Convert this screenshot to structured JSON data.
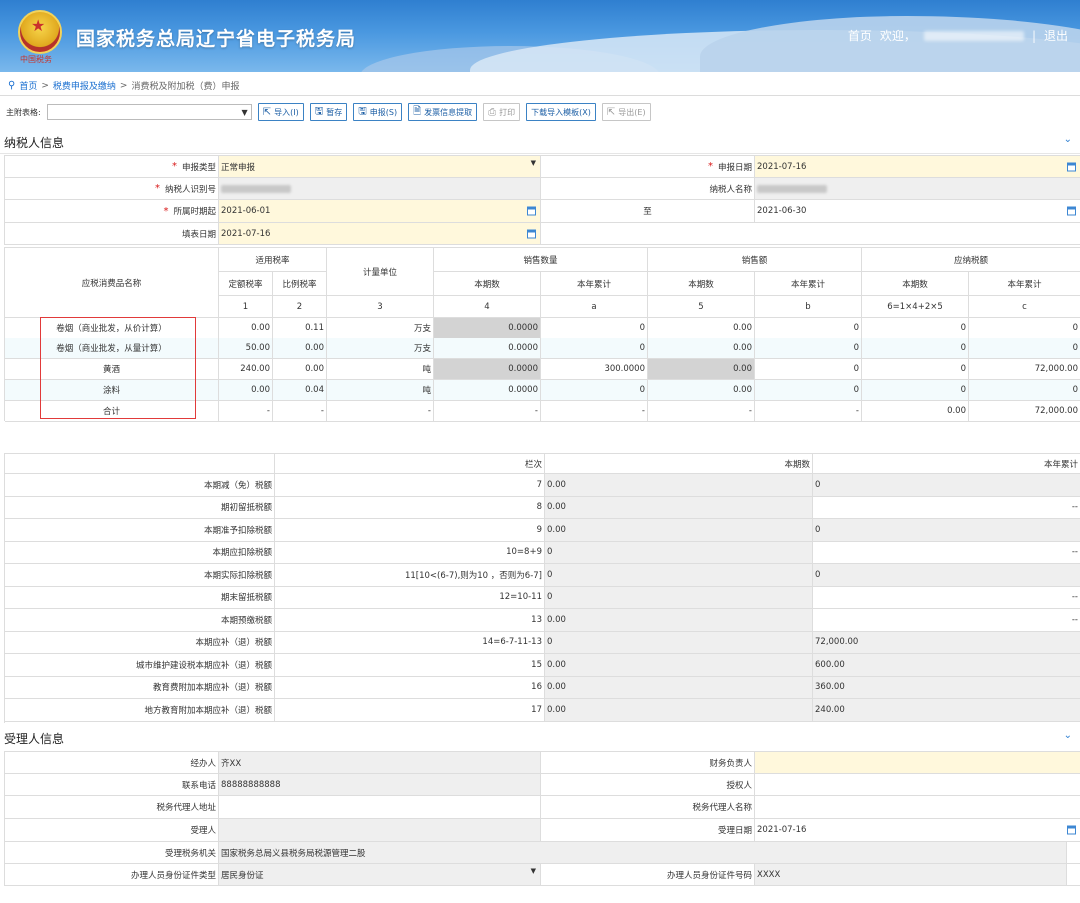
{
  "header": {
    "title": "国家税务总局辽宁省电子税务局",
    "emblem_text": "中国税务",
    "links": {
      "home": "首页",
      "welcome": "欢迎，",
      "sep": "|",
      "logout": "退出"
    }
  },
  "breadcrumb": {
    "items": [
      "首页",
      "税费申报及缴纳",
      "消费税及附加税（费）申报"
    ]
  },
  "toolbar": {
    "label": "主附表格:",
    "import": "导入(I)",
    "save": "暂存",
    "submit": "申报(S)",
    "invoice": "发票信息提取",
    "print": "打印",
    "download": "下载导入模板(X)",
    "export": "导出(E)"
  },
  "taxpayer": {
    "section": "纳税人信息",
    "decl_type_label": "申报类型",
    "decl_type": "正常申报",
    "decl_date_label": "申报日期",
    "decl_date": "2021-07-16",
    "tin_label": "纳税人识别号",
    "name_label": "纳税人名称",
    "period_start_label": "所属时期起",
    "period_start": "2021-06-01",
    "to_label": "至",
    "period_end": "2021-06-30",
    "fill_date_label": "填表日期",
    "fill_date": "2021-07-16"
  },
  "goods": {
    "headers": {
      "name": "应税消费品名称",
      "rate": "适用税率",
      "fixed": "定额税率",
      "ratio": "比例税率",
      "unit": "计量单位",
      "qty": "销售数量",
      "sales": "销售额",
      "tax": "应纳税额",
      "cur": "本期数",
      "ytd": "本年累计"
    },
    "codes": [
      "1",
      "2",
      "3",
      "4",
      "a",
      "5",
      "b",
      "6=1×4+2×5",
      "c"
    ],
    "rows": [
      [
        "卷烟（商业批发，从价计算）",
        "0.00",
        "0.11",
        "万支",
        "0.0000",
        "0",
        "0.00",
        "0",
        "0",
        "0"
      ],
      [
        "卷烟（商业批发，从量计算）",
        "50.00",
        "0.00",
        "万支",
        "0.0000",
        "0",
        "0.00",
        "0",
        "0",
        "0"
      ],
      [
        "黄酒",
        "240.00",
        "0.00",
        "吨",
        "0.0000",
        "300.0000",
        "0.00",
        "0",
        "0",
        "72,000.00"
      ],
      [
        "涂料",
        "0.00",
        "0.04",
        "吨",
        "0.0000",
        "0",
        "0.00",
        "0",
        "0",
        "0"
      ],
      [
        "合计",
        "-",
        "-",
        "-",
        "-",
        "-",
        "-",
        "-",
        "0.00",
        "72,000.00"
      ]
    ]
  },
  "calc": {
    "headers": {
      "line": "栏次",
      "cur": "本期数",
      "ytd": "本年累计"
    },
    "rows": [
      [
        "本期减（免）税额",
        "7",
        "0.00",
        "0"
      ],
      [
        "期初留抵税额",
        "8",
        "0.00",
        "--"
      ],
      [
        "本期准予扣除税额",
        "9",
        "0.00",
        "0"
      ],
      [
        "本期应扣除税额",
        "10=8+9",
        "0",
        "--"
      ],
      [
        "本期实际扣除税额",
        "11[10<(6-7),则为10 ，否则为6-7]",
        "0",
        "0"
      ],
      [
        "期末留抵税额",
        "12=10-11",
        "0",
        "--"
      ],
      [
        "本期预缴税额",
        "13",
        "0.00",
        "--"
      ],
      [
        "本期应补（退）税额",
        "14=6-7-11-13",
        "0",
        "72,000.00"
      ],
      [
        "城市维护建设税本期应补（退）税额",
        "15",
        "0.00",
        "600.00"
      ],
      [
        "教育费附加本期应补（退）税额",
        "16",
        "0.00",
        "360.00"
      ],
      [
        "地方教育附加本期应补（退）税额",
        "17",
        "0.00",
        "240.00"
      ]
    ]
  },
  "agent": {
    "section": "受理人信息",
    "handler_label": "经办人",
    "handler": "齐XX",
    "cfo_label": "财务负责人",
    "cfo": "",
    "phone_label": "联系电话",
    "phone": "88888888888",
    "auth_label": "授权人",
    "auth": "",
    "agent_addr_label": "税务代理人地址",
    "agent_addr": "",
    "agent_name_label": "税务代理人名称",
    "agent_name": "",
    "receiver_label": "受理人",
    "receiver": "",
    "recv_date_label": "受理日期",
    "recv_date": "2021-07-16",
    "office_label": "受理税务机关",
    "office": "国家税务总局义县税务局税源管理二股",
    "id_type_label": "办理人员身份证件类型",
    "id_type": "居民身份证",
    "id_no_label": "办理人员身份证件号码",
    "id_no": "XXXX"
  }
}
